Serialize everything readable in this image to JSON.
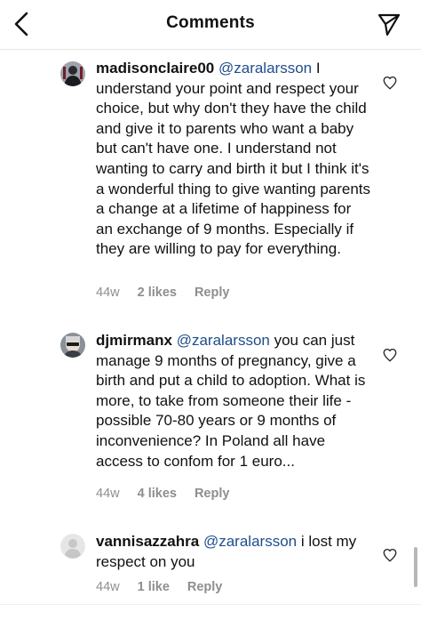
{
  "header": {
    "title": "Comments",
    "back_icon": "chevron-left-icon",
    "send_icon": "paper-plane-icon"
  },
  "comments": [
    {
      "username": "madisonclaire00",
      "mention": "@zaralarsson",
      "text": " I understand your point and respect your choice, but why don't they have the child and give it to parents who want a baby but can't have one. I understand not wanting to carry and birth it but I think it's a wonderful thing to give wanting parents a change at a lifetime of happiness for an exchange of 9 months. Especially if they are willing to pay for everything.",
      "time": "44w",
      "likes": "2 likes",
      "reply": "Reply"
    },
    {
      "username": "djmirmanx",
      "mention": "@zaralarsson",
      "text": " you can just manage 9 months of pregnancy, give a birth and put a child to adoption. What is more, to take from someone their life - possible 70-80 years or 9 months of inconvenience? In Poland all have access to confom for 1 euro...",
      "time": "44w",
      "likes": "4 likes",
      "reply": "Reply"
    },
    {
      "username": "vannisazzahra",
      "mention": "@zaralarsson",
      "text": " i lost my respect on you",
      "time": "44w",
      "likes": "1 like",
      "reply": "Reply"
    }
  ],
  "colors": {
    "mention": "#1f4e8c",
    "meta": "#8e8e8e",
    "text": "#111111"
  }
}
